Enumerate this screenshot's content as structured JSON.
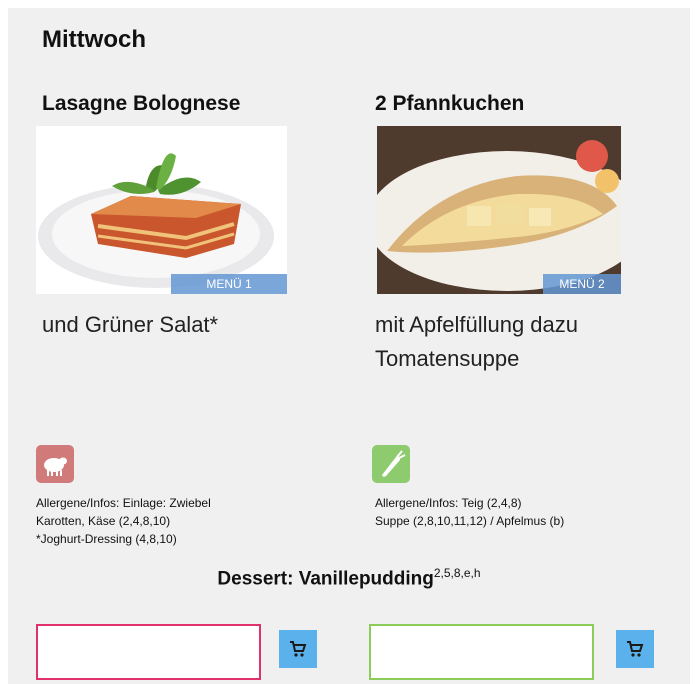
{
  "day": "Mittwoch",
  "menus": [
    {
      "title": "Lasagne Bolognese",
      "badge": "MENÜ 1",
      "description_lines": [
        "und Grüner Salat*"
      ],
      "diet_icon": "lamb-icon",
      "diet_color": "#d17a7a",
      "allergen_lines": [
        "Allergene/Infos: Einlage: Zwiebel",
        "Karotten, Käse (2,4,8,10)",
        "*Joghurt-Dressing (4,8,10)"
      ],
      "order_border_color": "#e0306e"
    },
    {
      "title": "2 Pfannkuchen",
      "badge": "MENÜ 2",
      "description_lines": [
        "mit Apfelfüllung dazu",
        "Tomatensuppe"
      ],
      "diet_icon": "carrot-icon",
      "diet_color": "#8ecb6e",
      "allergen_lines": [
        "Allergene/Infos: Teig (2,4,8)",
        "Suppe (2,8,10,11,12) / Apfelmus (b)"
      ],
      "order_border_color": "#8ccc5a"
    }
  ],
  "dessert": {
    "label": "Dessert: Vanillepudding",
    "allergens": "2,5,8,e,h"
  },
  "cart_icon": "cart-icon",
  "accent_color": "#5ab1ec"
}
